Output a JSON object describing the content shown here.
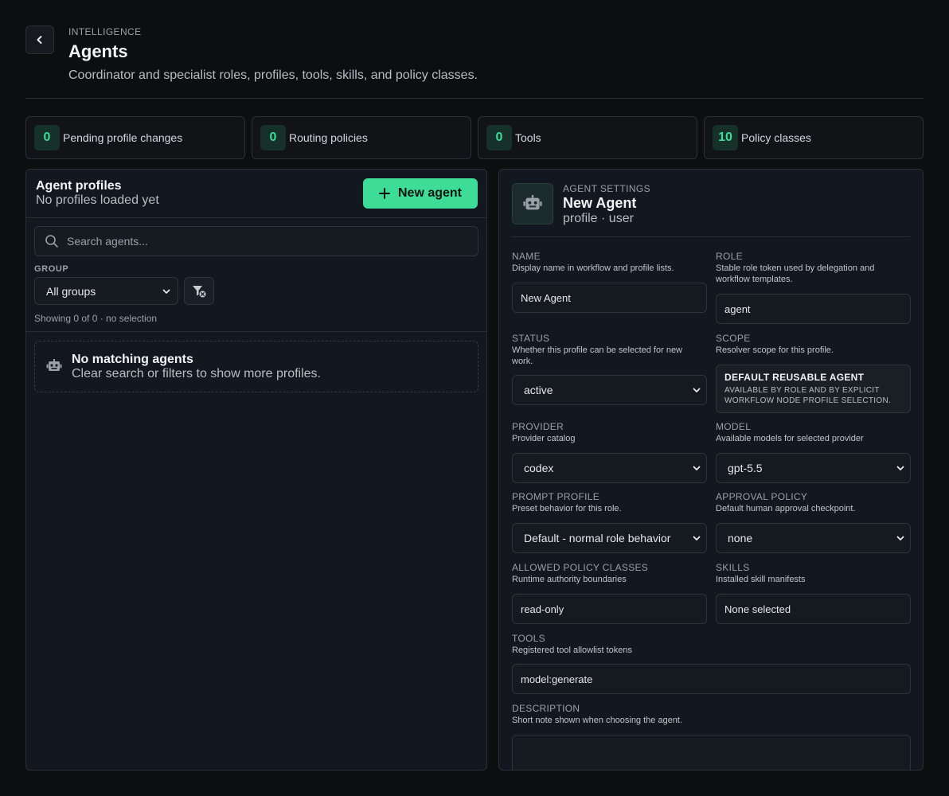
{
  "header": {
    "eyebrow": "INTELLIGENCE",
    "title": "Agents",
    "subtitle": "Coordinator and specialist roles, profiles, tools, skills, and policy classes."
  },
  "stats": [
    {
      "value": "0",
      "label": "Pending profile changes"
    },
    {
      "value": "0",
      "label": "Routing policies"
    },
    {
      "value": "0",
      "label": "Tools"
    },
    {
      "value": "10",
      "label": "Policy classes"
    }
  ],
  "profiles": {
    "title": "Agent profiles",
    "subtitle": "No profiles loaded yet",
    "new_button": "New agent",
    "search_placeholder": "Search agents...",
    "group_label": "GROUP",
    "group_value": "All groups",
    "showing": "Showing 0 of 0 · no selection",
    "empty_title": "No matching agents",
    "empty_sub": "Clear search or filters to show more profiles."
  },
  "settings": {
    "eyebrow": "AGENT SETTINGS",
    "title": "New Agent",
    "subtitle": "profile · user",
    "name": {
      "label": "NAME",
      "help": "Display name in workflow and profile lists.",
      "value": "New Agent"
    },
    "role": {
      "label": "ROLE",
      "help": "Stable role token used by delegation and workflow templates.",
      "value": "agent"
    },
    "status": {
      "label": "STATUS",
      "help": "Whether this profile can be selected for new work.",
      "value": "active"
    },
    "scope": {
      "label": "SCOPE",
      "help": "Resolver scope for this profile.",
      "title": "DEFAULT REUSABLE AGENT",
      "desc": "AVAILABLE BY ROLE AND BY EXPLICIT WORKFLOW NODE PROFILE SELECTION."
    },
    "provider": {
      "label": "PROVIDER",
      "help": "Provider catalog",
      "value": "codex"
    },
    "model": {
      "label": "MODEL",
      "help": "Available models for selected provider",
      "value": "gpt-5.5"
    },
    "prompt_profile": {
      "label": "PROMPT PROFILE",
      "help": "Preset behavior for this role.",
      "value": "Default - normal role behavior"
    },
    "approval_policy": {
      "label": "APPROVAL POLICY",
      "help": "Default human approval checkpoint.",
      "value": "none"
    },
    "policy_classes": {
      "label": "ALLOWED POLICY CLASSES",
      "help": "Runtime authority boundaries",
      "value": "read-only"
    },
    "skills": {
      "label": "SKILLS",
      "help": "Installed skill manifests",
      "value": "None selected"
    },
    "tools": {
      "label": "TOOLS",
      "help": "Registered tool allowlist tokens",
      "value": "model:generate"
    },
    "description": {
      "label": "DESCRIPTION",
      "help": "Short note shown when choosing the agent.",
      "value": ""
    }
  }
}
